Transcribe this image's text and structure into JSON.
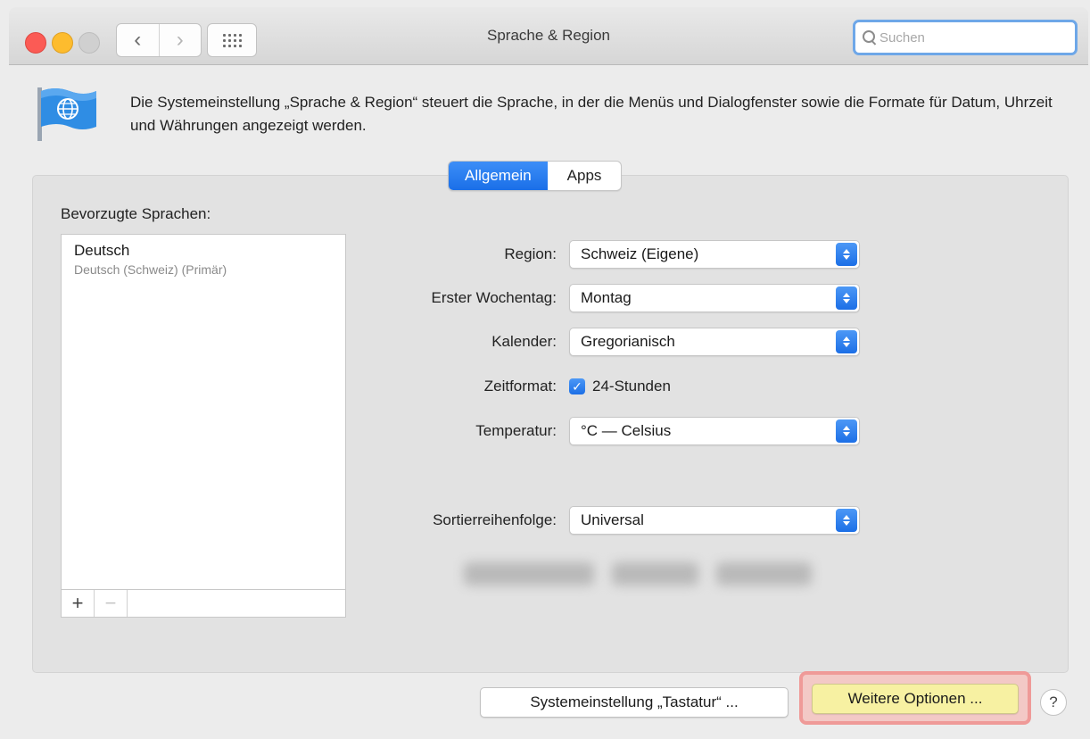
{
  "window": {
    "title": "Sprache & Region",
    "search_placeholder": "Suchen",
    "nav_back": "‹",
    "nav_forward": "›"
  },
  "header": {
    "description": "Die Systemeinstellung „Sprache & Region“ steuert die Sprache, in der die Menüs und Dialogfenster sowie die Formate für Datum, Uhrzeit und Währungen angezeigt werden.",
    "icon": "flag-globe-icon"
  },
  "tabs": [
    {
      "label": "Allgemein",
      "active": true
    },
    {
      "label": "Apps",
      "active": false
    }
  ],
  "languages": {
    "heading": "Bevorzugte Sprachen:",
    "items": [
      {
        "name": "Deutsch",
        "detail": "Deutsch (Schweiz) (Primär)"
      }
    ],
    "add_label": "+",
    "remove_label": "−"
  },
  "settings": {
    "region": {
      "label": "Region:",
      "value": "Schweiz (Eigene)"
    },
    "first_weekday": {
      "label": "Erster Wochentag:",
      "value": "Montag"
    },
    "calendar": {
      "label": "Kalender:",
      "value": "Gregorianisch"
    },
    "time_format": {
      "label": "Zeitformat:",
      "checkbox_label": "24-Stunden",
      "checked": true
    },
    "temperature": {
      "label": "Temperatur:",
      "value": "°C — Celsius"
    },
    "sort_order": {
      "label": "Sortierreihenfolge:",
      "value": "Universal"
    }
  },
  "footer": {
    "keyboard_button": "Systemeinstellung „Tastatur“ ...",
    "options_button": "Weitere Optionen ...",
    "help_label": "?"
  },
  "colors": {
    "accent": "#1c6fe6",
    "highlight_ring": "#ef9a98",
    "highlight_button": "#f7f1a2"
  }
}
